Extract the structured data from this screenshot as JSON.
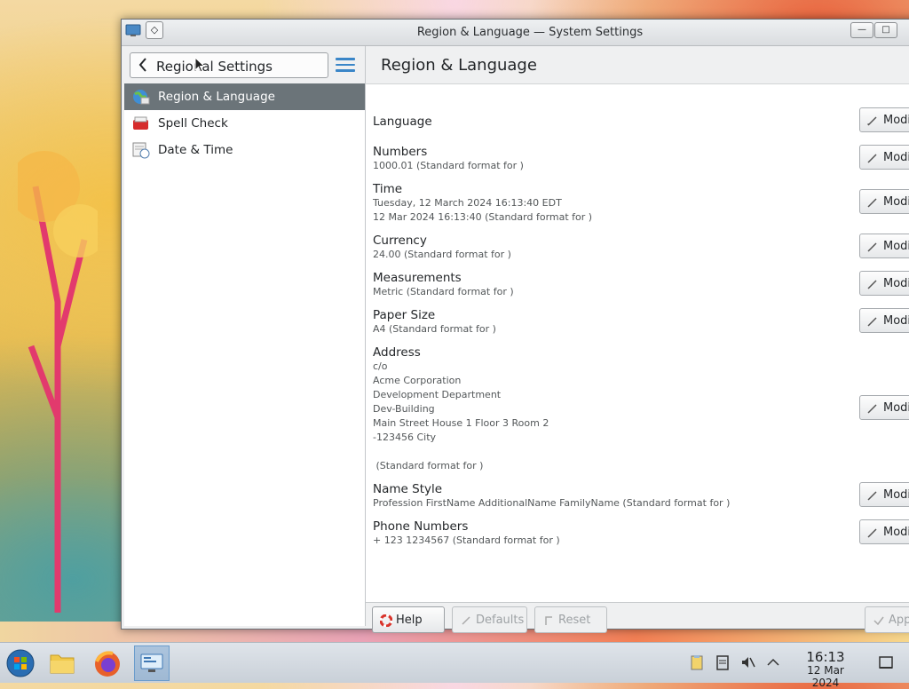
{
  "window": {
    "title": "Region & Language — System Settings"
  },
  "sidebar": {
    "back_label": "Regional Settings",
    "items": [
      {
        "label": "Region & Language",
        "icon": "globe-icon",
        "selected": true
      },
      {
        "label": "Spell Check",
        "icon": "spellcheck-icon",
        "selected": false
      },
      {
        "label": "Date & Time",
        "icon": "calendar-clock-icon",
        "selected": false
      }
    ]
  },
  "main": {
    "title": "Region & Language",
    "modify_label": "Modify",
    "settings": [
      {
        "name": "Language",
        "lines": []
      },
      {
        "name": "Numbers",
        "lines": [
          "1000.01 (Standard format for )"
        ]
      },
      {
        "name": "Time",
        "lines": [
          "Tuesday, 12 March 2024 16:13:40 EDT",
          "12 Mar 2024 16:13:40 (Standard format for )"
        ]
      },
      {
        "name": "Currency",
        "lines": [
          "24.00 (Standard format for )"
        ]
      },
      {
        "name": "Measurements",
        "lines": [
          "Metric (Standard format for )"
        ]
      },
      {
        "name": "Paper Size",
        "lines": [
          "A4 (Standard format for )"
        ]
      },
      {
        "name": "Address",
        "lines": [
          "c/o",
          "Acme Corporation",
          "Development Department",
          "Dev-Building",
          "Main Street House 1 Floor 3 Room 2",
          "-123456 City",
          "",
          " (Standard format for )"
        ]
      },
      {
        "name": "Name Style",
        "lines": [
          "Profession FirstName AdditionalName FamilyName (Standard format for )"
        ]
      },
      {
        "name": "Phone Numbers",
        "lines": [
          "+ 123 1234567 (Standard format for )"
        ]
      }
    ]
  },
  "footer": {
    "help_label": "Help",
    "defaults_label": "Defaults",
    "reset_label": "Reset",
    "apply_label": "Apply"
  },
  "taskbar": {
    "apps": [
      "start-menu-icon",
      "file-manager-icon",
      "firefox-icon",
      "system-settings-icon"
    ],
    "clock_time": "16:13",
    "clock_date": "12 Mar 2024"
  },
  "colors": {
    "selection": "#6b7479",
    "accent": "#3a86c8"
  }
}
